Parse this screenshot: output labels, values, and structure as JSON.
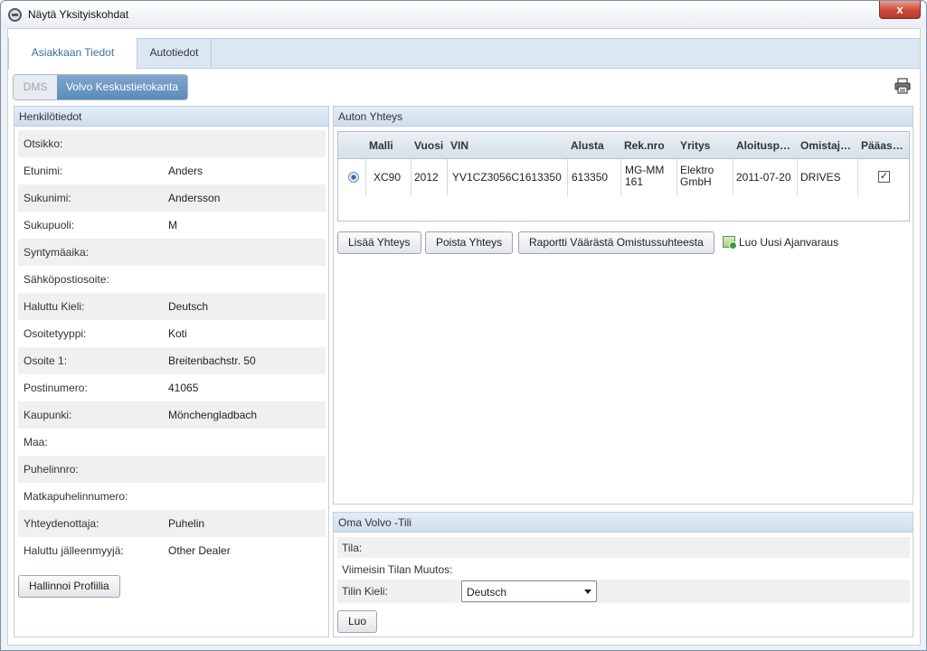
{
  "window": {
    "title": "Näytä Yksityiskohdat",
    "close_glyph": "x"
  },
  "tabs": [
    {
      "label": "Asiakkaan Tiedot",
      "active": true
    },
    {
      "label": "Autotiedot",
      "active": false
    }
  ],
  "source_toggle": {
    "dms_label": "DMS",
    "central_label": "Volvo Keskustietokanta",
    "selected": "Volvo Keskustietokanta"
  },
  "personal": {
    "header": "Henkilötiedot",
    "fields": [
      {
        "label": "Otsikko:",
        "value": ""
      },
      {
        "label": "Etunimi:",
        "value": "Anders"
      },
      {
        "label": "Sukunimi:",
        "value": "Andersson"
      },
      {
        "label": "Sukupuoli:",
        "value": "M"
      },
      {
        "label": "Syntymäaika:",
        "value": ""
      },
      {
        "label": "Sähköpostiosoite:",
        "value": ""
      },
      {
        "label": "Haluttu Kieli:",
        "value": "Deutsch"
      },
      {
        "label": "Osoitetyyppi:",
        "value": "Koti"
      },
      {
        "label": "Osoite 1:",
        "value": "Breitenbachstr. 50"
      },
      {
        "label": "Postinumero:",
        "value": "41065"
      },
      {
        "label": "Kaupunki:",
        "value": "Mönchengladbach"
      },
      {
        "label": "Maa:",
        "value": ""
      },
      {
        "label": "Puhelinnro:",
        "value": ""
      },
      {
        "label": "Matkapuhelinnumero:",
        "value": ""
      },
      {
        "label": "Yhteydenottaja:",
        "value": "Puhelin"
      },
      {
        "label": "Haluttu jälleenmyyjä:",
        "value": "Other Dealer"
      }
    ],
    "manage_button": "Hallinnoi Profiilia"
  },
  "vehicle": {
    "header": "Auton Yhteys",
    "columns": [
      "Malli",
      "Vuosi",
      "VIN",
      "Alusta",
      "Rek.nro",
      "Yritys",
      "Aloitusp…",
      "Omistaj…",
      "Pääas…"
    ],
    "rows": [
      {
        "selected": true,
        "cells": [
          "XC90",
          "2012",
          "YV1CZ3056C1613350",
          "613350",
          "MG-MM 161",
          "Elektro GmbH",
          "2011-07-20",
          "DRIVES"
        ],
        "primary": true
      }
    ],
    "checkbox_glyph": "✓",
    "buttons": {
      "add": "Lisää Yhteys",
      "remove": "Poista Yhteys",
      "report": "Raportti Väärästä Omistussuhteesta"
    },
    "new_appointment": "Luo Uusi Ajanvaraus"
  },
  "my_volvo": {
    "header": "Oma Volvo -Tili",
    "status_label": "Tila:",
    "status_value": "",
    "last_change_label": "Viimeisin Tilan Muutos:",
    "last_change_value": "",
    "language_label": "Tilin Kieli:",
    "language_value": "Deutsch",
    "create_button": "Luo"
  }
}
